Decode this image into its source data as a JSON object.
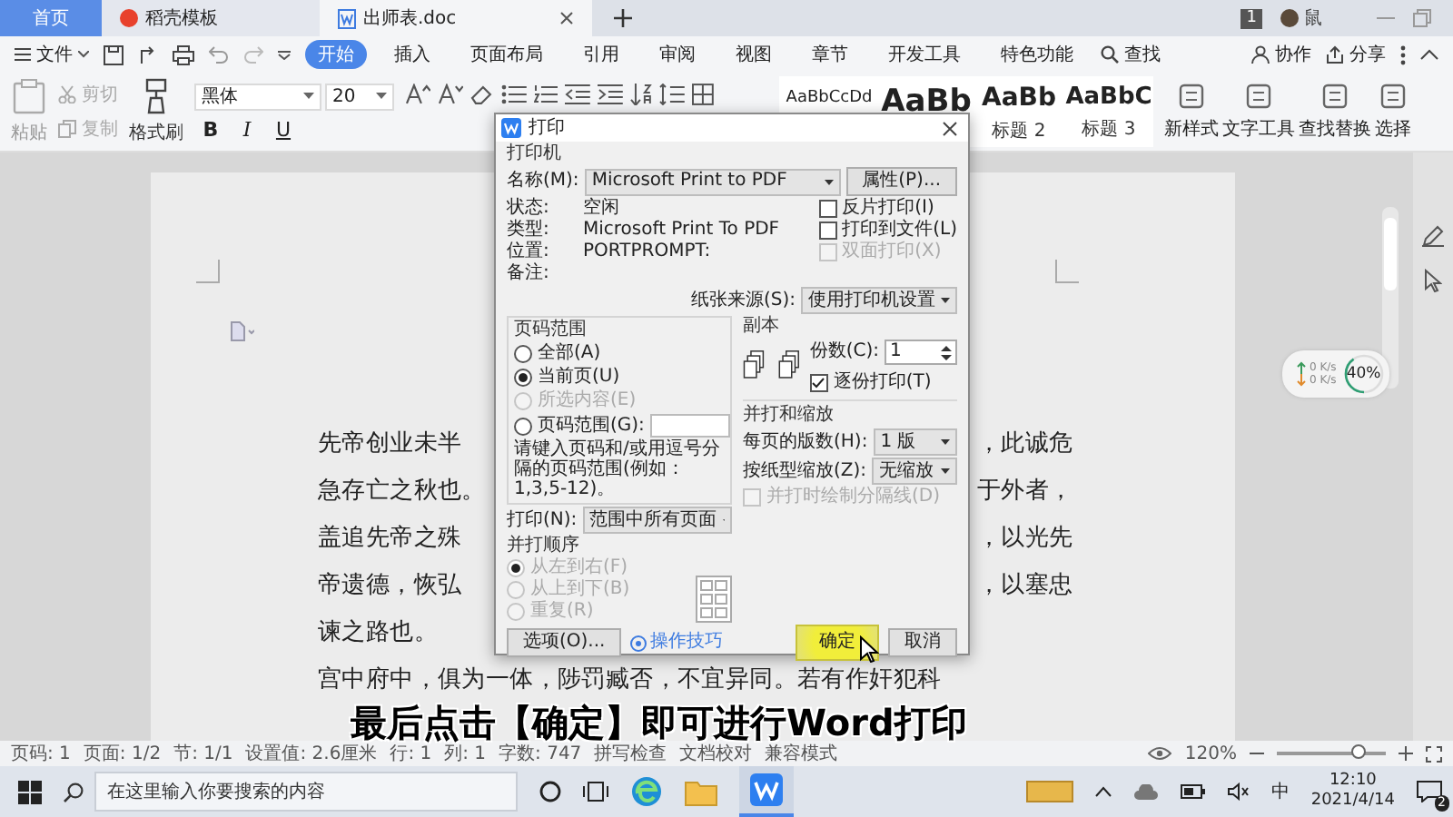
{
  "tabs": [
    {
      "label": "首页",
      "kind": "home",
      "selected": false
    },
    {
      "label": "稻壳模板",
      "kind": "template",
      "selected": false
    },
    {
      "label": "出师表.doc",
      "kind": "doc",
      "selected": true
    }
  ],
  "account": {
    "badge": "1",
    "name": "鼠"
  },
  "menu": {
    "file": "文件",
    "tabs": [
      {
        "label": "开始",
        "selected": true
      },
      {
        "label": "插入",
        "selected": false
      },
      {
        "label": "页面布局",
        "selected": false
      },
      {
        "label": "引用",
        "selected": false
      },
      {
        "label": "审阅",
        "selected": false
      },
      {
        "label": "视图",
        "selected": false
      },
      {
        "label": "章节",
        "selected": false
      },
      {
        "label": "开发工具",
        "selected": false
      },
      {
        "label": "特色功能",
        "selected": false
      }
    ],
    "search": "查找",
    "collab": "协作",
    "share": "分享"
  },
  "ribbon": {
    "paste": "粘贴",
    "cut": "剪切",
    "copy": "复制",
    "format_painter": "格式刷",
    "font": "黑体",
    "size": "20",
    "format_marks": [
      "B",
      "I",
      "U"
    ],
    "styles": [
      {
        "sample": "AaBbCcDd"
      },
      {
        "sample": "AaBb"
      },
      {
        "sample": "AaBb",
        "label": "标题 2"
      },
      {
        "sample": "AaBbC",
        "label": "标题 3"
      }
    ],
    "tools": [
      "新样式",
      "文字工具",
      "查找替换",
      "选择"
    ]
  },
  "document": {
    "lines": [
      {
        "left": "先帝创业未半",
        "right": "，此诚危"
      },
      {
        "left": "急存亡之秋也。",
        "right": "于外者，"
      },
      {
        "left": "盖追先帝之殊",
        "right": "，以光先"
      },
      {
        "left": "帝遗德，恢弘",
        "right": "，以塞忠"
      },
      {
        "left": "谏之路也。"
      },
      {
        "left": "宫中府中，俱为一体，陟罚臧否，不宜异同。若有作奸犯科"
      }
    ]
  },
  "print_dialog": {
    "title": "打印",
    "printer_label": "打印机",
    "name_label": "名称(M):",
    "printer": "Microsoft Print to PDF",
    "properties": "属性(P)...",
    "info": [
      {
        "label": "状态:",
        "value": "空闲"
      },
      {
        "label": "类型:",
        "value": "Microsoft Print To PDF"
      },
      {
        "label": "位置:",
        "value": "PORTPROMPT:"
      },
      {
        "label": "备注:"
      }
    ],
    "options": [
      {
        "label": "反片打印(I)",
        "checked": false,
        "disabled": false
      },
      {
        "label": "打印到文件(L)",
        "checked": false,
        "disabled": false
      },
      {
        "label": "双面打印(X)",
        "checked": false,
        "disabled": true
      }
    ],
    "paper_source_label": "纸张来源(S):",
    "paper_source": "使用打印机设置",
    "range": {
      "title": "页码范围",
      "choices": [
        {
          "label": "全部(A)",
          "selected": false,
          "disabled": false
        },
        {
          "label": "当前页(U)",
          "selected": true,
          "disabled": false
        },
        {
          "label": "所选内容(E)",
          "selected": false,
          "disabled": true
        },
        {
          "label": "页码范围(G):",
          "selected": false,
          "disabled": false
        }
      ],
      "hint": "请键入页码和/或用逗号分隔的页码范围(例如：1,3,5-12)。"
    },
    "print_label": "打印(N):",
    "print_what": "范围中所有页面",
    "order": {
      "title": "并打顺序",
      "disabled": true,
      "choices": [
        {
          "label": "从左到右(F)",
          "selected": true
        },
        {
          "label": "从上到下(B)",
          "selected": false
        },
        {
          "label": "重复(R)",
          "selected": false
        }
      ]
    },
    "copies": {
      "title": "副本",
      "label": "份数(C):",
      "value": "1",
      "collate": {
        "label": "逐份打印(T)",
        "checked": true
      }
    },
    "zoom": {
      "title": "并打和缩放",
      "rows": [
        {
          "label": "每页的版数(H):",
          "value": "1 版"
        },
        {
          "label": "按纸型缩放(Z):",
          "value": "无缩放"
        }
      ],
      "divider": {
        "label": "并打时绘制分隔线(D)",
        "checked": false,
        "disabled": true
      }
    },
    "buttons": {
      "options": "选项(O)...",
      "tips": "操作技巧",
      "ok": "确定",
      "cancel": "取消"
    }
  },
  "speed_widget": {
    "up": "0 K/s",
    "down": "0 K/s",
    "percent": "40%",
    "level": 0.4
  },
  "caption": "最后点击【确定】即可进行Word打印",
  "status_bar": {
    "items": [
      "页码: 1",
      "页面: 1/2",
      "节: 1/1",
      "设置值: 2.6厘米",
      "行: 1",
      "列: 1",
      "字数: 747",
      "拼写检查",
      "文档校对",
      "兼容模式"
    ],
    "zoom": "120%",
    "level": 0.75
  },
  "taskbar": {
    "search_placeholder": "在这里输入你要搜索的内容",
    "ime": "中",
    "time": "12:10",
    "date": "2021/4/14",
    "notifications": "2"
  }
}
